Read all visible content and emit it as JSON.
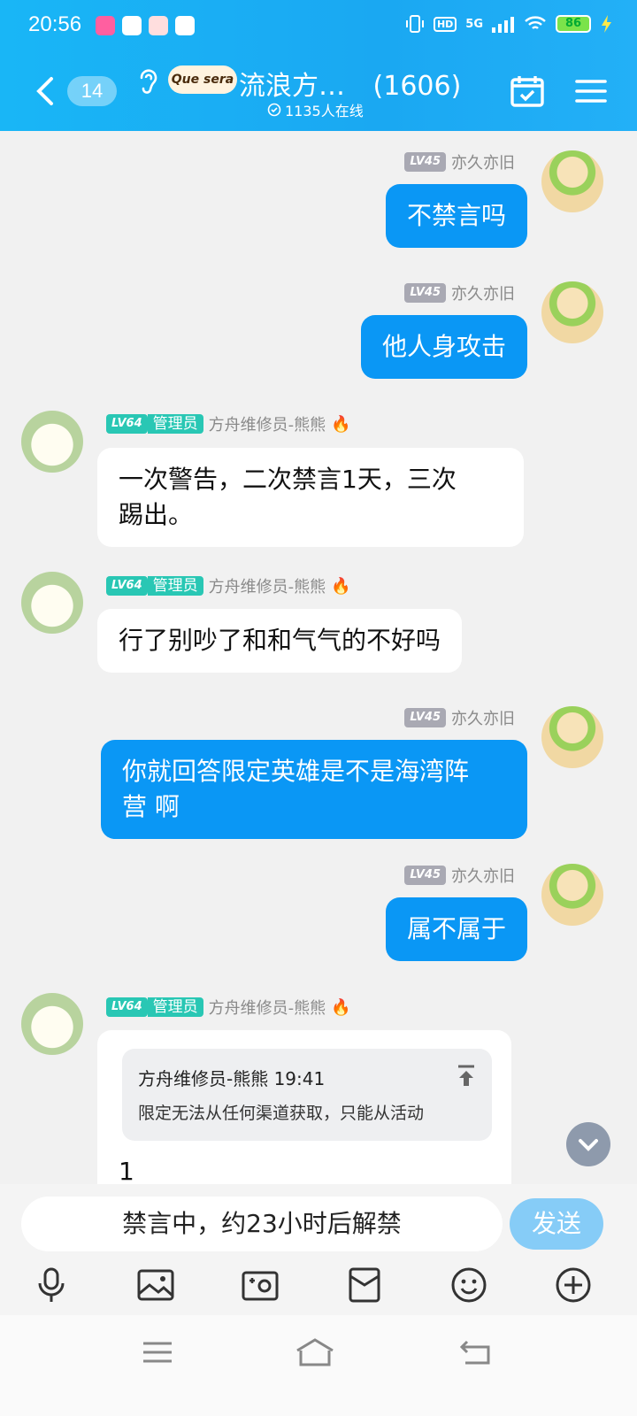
{
  "status_bar": {
    "time": "20:56",
    "hd": "HD",
    "network": "5G",
    "battery": "86"
  },
  "header": {
    "unread_badge": "14",
    "logo_text": "Que sera",
    "group_name": "流浪方…",
    "member_count": "(1606)",
    "online_text": "1135人在线"
  },
  "messages": [
    {
      "level": "LV45",
      "name": "亦久亦旧",
      "text": "不禁言吗"
    },
    {
      "level": "LV45",
      "name": "亦久亦旧",
      "text": "他人身攻击"
    },
    {
      "level": "LV64",
      "role": "管理员",
      "name": "方舟维修员-熊熊",
      "lines": [
        "一次警告，二次禁言1天，三次",
        "踢出。"
      ]
    },
    {
      "level": "LV64",
      "role": "管理员",
      "name": "方舟维修员-熊熊",
      "text": "行了别吵了和和气气的不好吗"
    },
    {
      "level": "LV45",
      "name": "亦久亦旧",
      "lines": [
        "你就回答限定英雄是不是海湾阵",
        "营 啊"
      ]
    },
    {
      "level": "LV45",
      "name": "亦久亦旧",
      "text": "属不属于"
    },
    {
      "level": "LV64",
      "role": "管理员",
      "name": "方舟维修员-熊熊",
      "quote_header": "方舟维修员-熊熊 19:41",
      "quote_text": "限定无法从任何渠道获取，只能从活动",
      "text": "1"
    }
  ],
  "input": {
    "placeholder": "禁言中，约23小时后解禁",
    "send_label": "发送"
  },
  "colors": {
    "header": "#19b6f6",
    "bubble_self": "#0a97f5",
    "level_admin": "#29c7b4",
    "level_member": "#a9a9b3"
  }
}
